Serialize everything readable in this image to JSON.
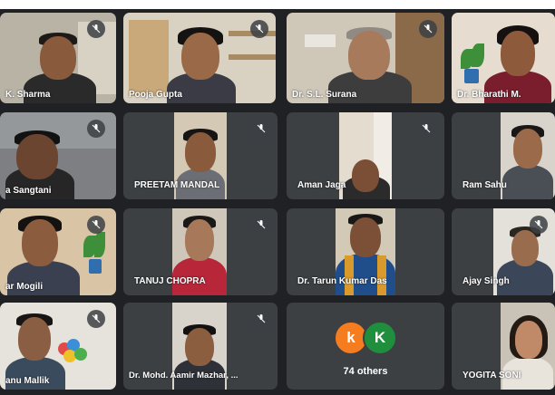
{
  "colors": {
    "background": "#202124",
    "tile": "#3c4043",
    "label_text": "#ffffff",
    "avatar_k_orange": "#f57c1f",
    "avatar_k_green": "#1f8e3d"
  },
  "mute_icon": "mic-off-icon",
  "tiles": [
    {
      "name": "K. Sharma",
      "muted": true
    },
    {
      "name": "Pooja Gupta",
      "muted": true
    },
    {
      "name": "Dr. S.L. Surana",
      "muted": true
    },
    {
      "name": "Dr. Bharathi M.",
      "muted": false
    },
    {
      "name": "a Sangtani",
      "muted": true
    },
    {
      "name": "PREETAM MANDAL",
      "muted": true
    },
    {
      "name": "Aman Jaga",
      "muted": true
    },
    {
      "name": "Ram Sahu",
      "muted": true
    },
    {
      "name": "ar Mogili",
      "muted": true
    },
    {
      "name": "TANUJ CHOPRA",
      "muted": true
    },
    {
      "name": "Dr. Tarun Kumar Das",
      "muted": true
    },
    {
      "name": "Ajay Singh",
      "muted": false
    },
    {
      "name": "anu Mallik",
      "muted": true
    },
    {
      "name": "Dr. Mohd. Aamir Mazhar, ...",
      "muted": true
    },
    {
      "name": "YOGITA SONI",
      "muted": false
    }
  ],
  "others": {
    "avatars": [
      "k",
      "K"
    ],
    "label": "74 others"
  }
}
